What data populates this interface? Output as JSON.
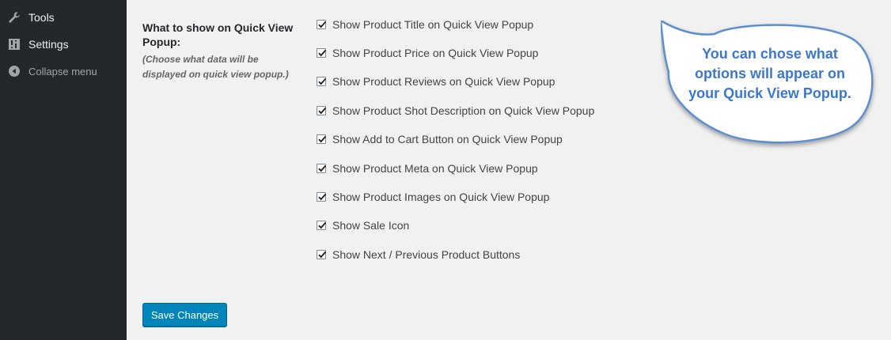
{
  "sidebar": {
    "items": [
      {
        "label": "Tools",
        "icon": "wrench-icon"
      },
      {
        "label": "Settings",
        "icon": "settings-icon"
      },
      {
        "label": "Collapse menu",
        "icon": "collapse-icon"
      }
    ]
  },
  "section": {
    "label": "What to show on Quick View Popup:",
    "note": "(Choose what data will be displayed on quick view popup.)"
  },
  "options": [
    {
      "label": "Show Product Title on Quick View Popup",
      "checked": true
    },
    {
      "label": "Show Product Price on Quick View Popup",
      "checked": true
    },
    {
      "label": "Show Product Reviews on Quick View Popup",
      "checked": true
    },
    {
      "label": "Show Product Shot Description on Quick View Popup",
      "checked": true
    },
    {
      "label": "Show Add to Cart Button on Quick View Popup",
      "checked": true
    },
    {
      "label": "Show Product Meta on Quick View Popup",
      "checked": true
    },
    {
      "label": "Show Product Images on Quick View Popup",
      "checked": true
    },
    {
      "label": "Show Sale Icon",
      "checked": true
    },
    {
      "label": "Show Next / Previous Product Buttons",
      "checked": true
    }
  ],
  "save_button": {
    "label": "Save Changes"
  },
  "callout": {
    "text": "You can chose what options will appear on your Quick View Popup."
  },
  "colors": {
    "sidebar_bg": "#23282d",
    "page_bg": "#f1f1f1",
    "primary_button": "#0085ba",
    "callout_text": "#3c78c8"
  }
}
